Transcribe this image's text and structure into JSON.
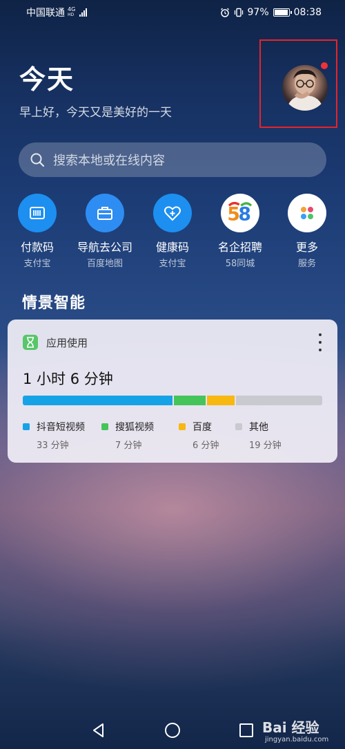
{
  "status_bar": {
    "carrier": "中国联通",
    "network_top": "4G",
    "network_bottom": "HD",
    "battery": "97%",
    "battery_level": 0.97,
    "time": "08:38"
  },
  "header": {
    "title": "今天",
    "greeting": "早上好，今天又是美好的一天"
  },
  "search": {
    "placeholder": "搜索本地或在线内容"
  },
  "shortcuts": [
    {
      "label": "付款码",
      "sub": "支付宝",
      "icon": "barcode-icon",
      "color": "#1d8ff0"
    },
    {
      "label": "导航去公司",
      "sub": "百度地图",
      "icon": "briefcase-icon",
      "color": "#2e8df2"
    },
    {
      "label": "健康码",
      "sub": "支付宝",
      "icon": "heart-plus-icon",
      "color": "#1d8ff0"
    },
    {
      "label": "名企招聘",
      "sub": "58同城",
      "icon": "58-logo-icon",
      "color": "#ffffff"
    },
    {
      "label": "更多",
      "sub": "服务",
      "icon": "apps-grid-icon",
      "color": "#ffffff"
    }
  ],
  "section_title": "情景智能",
  "usage_card": {
    "app_name": "应用使用",
    "total": "1 小时 6 分钟",
    "items": [
      {
        "name": "抖音短视频",
        "duration": "33 分钟",
        "minutes": 33,
        "color": "#16a3e6"
      },
      {
        "name": "搜狐视频",
        "duration": "7 分钟",
        "minutes": 7,
        "color": "#45c45a"
      },
      {
        "name": "百度",
        "duration": "6 分钟",
        "minutes": 6,
        "color": "#f6b811"
      },
      {
        "name": "其他",
        "duration": "19 分钟",
        "minutes": 19,
        "color": "#c9c9d0"
      }
    ]
  },
  "watermark": {
    "text": "Bai 经验",
    "url": "jingyan.baidu.com"
  }
}
